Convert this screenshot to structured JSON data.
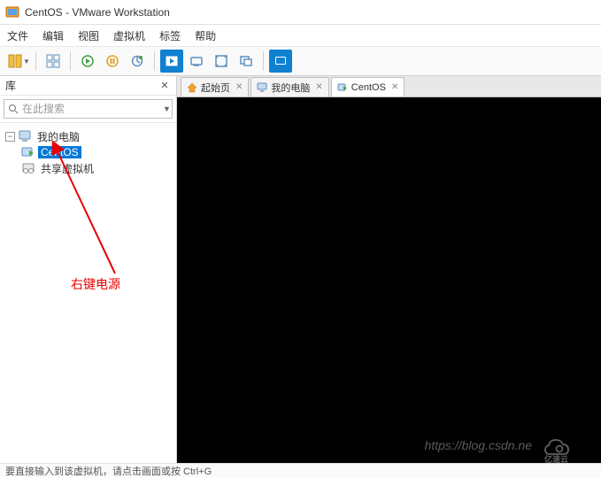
{
  "window": {
    "title": "CentOS - VMware Workstation"
  },
  "menu": {
    "file": "文件",
    "edit": "编辑",
    "view": "视图",
    "vm": "虚拟机",
    "tabs": "标签",
    "help": "帮助"
  },
  "sidebar": {
    "title": "库",
    "search_placeholder": "在此搜索",
    "tree": {
      "root_label": "我的电脑",
      "items": [
        {
          "label": "CentOS",
          "selected": true
        },
        {
          "label": "共享虚拟机",
          "selected": false
        }
      ]
    }
  },
  "tabs": [
    {
      "label": "起始页",
      "icon": "home",
      "active": false
    },
    {
      "label": "我的电脑",
      "icon": "computer",
      "active": false
    },
    {
      "label": "CentOS",
      "icon": "vm",
      "active": true
    }
  ],
  "statusbar": {
    "text": "要直接输入到该虚拟机，请点击画面或按 Ctrl+G"
  },
  "annotation": {
    "text": "右键电源"
  },
  "watermark": {
    "url": "https://blog.csdn.ne",
    "logo": "亿速云"
  }
}
